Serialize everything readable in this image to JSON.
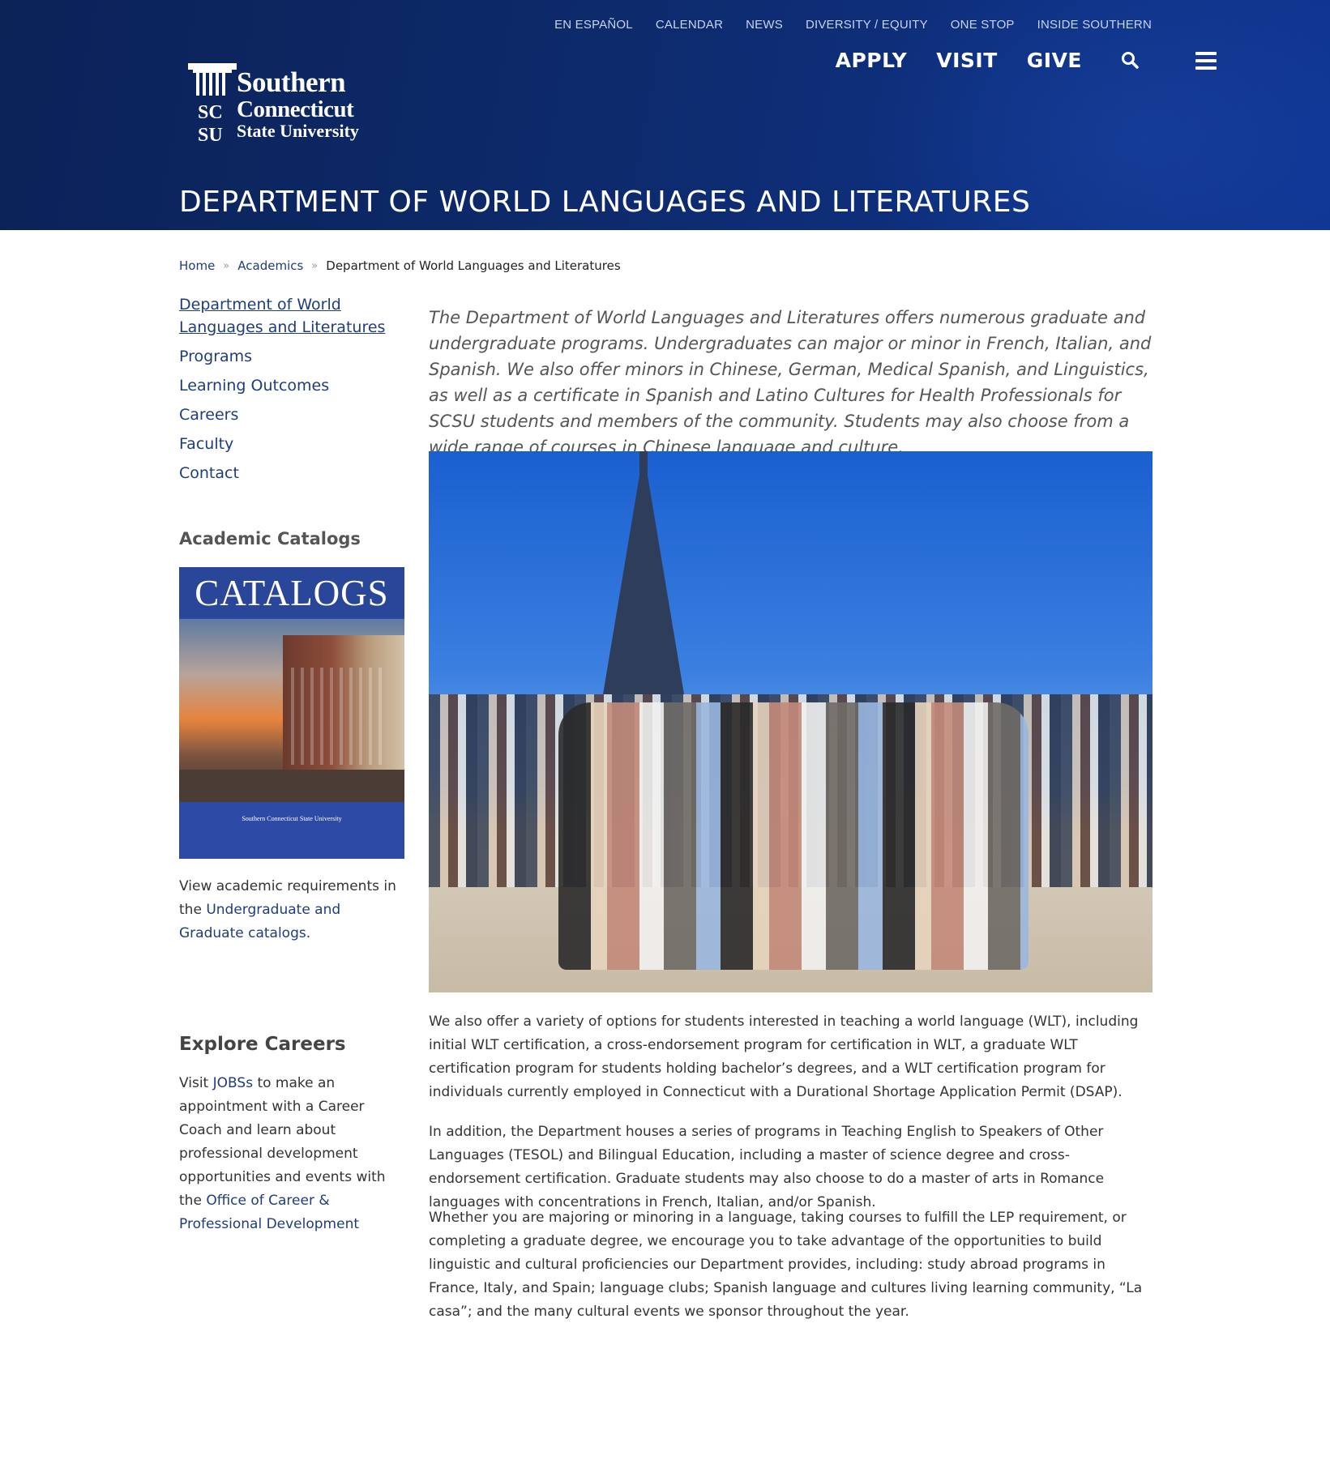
{
  "header": {
    "top_links": [
      "EN ESPAÑOL",
      "CALENDAR",
      "NEWS",
      "DIVERSITY / EQUITY",
      "ONE STOP",
      "INSIDE SOUTHERN"
    ],
    "nav": [
      "APPLY",
      "VISIT",
      "GIVE"
    ],
    "logo": {
      "line1": "Southern",
      "line2": "Connecticut",
      "line3": "State University",
      "mark": "SC SU"
    },
    "page_title": "DEPARTMENT OF WORLD LANGUAGES AND LITERATURES"
  },
  "breadcrumb": [
    "Home",
    "Academics",
    "Department of World Languages and Literatures"
  ],
  "sidebar": {
    "items": [
      "Department of World Languages and Literatures",
      "Programs",
      "Learning Outcomes",
      "Careers",
      "Faculty",
      "Contact"
    ],
    "catalogs_heading": "Academic Catalogs",
    "catalog_image": {
      "title": "CATALOGS",
      "footer": "Southern Connecticut State University"
    },
    "catalogs_text_prefix": "View academic requirements in the",
    "catalogs_link": "Undergraduate and Graduate catalogs",
    "catalogs_text_suffix": ".",
    "careers_heading": "Explore Careers",
    "careers_visit": "Visit",
    "careers_link1": "JOBSs",
    "careers_text": "to make an appointment with a Career Coach and learn about professional development opportunities and events with the",
    "careers_link2": "Office of Career & Professional Development"
  },
  "main": {
    "lead": "The Department of World Languages and Literatures offers numerous graduate and undergraduate programs. Undergraduates can major or minor in French, Italian, and Spanish. We also offer minors in Chinese, German, Medical Spanish, and Linguistics, as well as a certificate in Spanish and Latino Cultures for Health Professionals for SCSU students and members of the community. Students may also choose from a wide range of courses in Chinese language and culture.",
    "para1": "We also offer a variety of options for students interested in teaching a world language (WLT), including initial WLT certification, a cross-endorsement program for certification in WLT, a graduate WLT certification program for students holding bachelor’s degrees, and a WLT certification program for individuals currently employed in Connecticut with a Durational Shortage Application Permit (DSAP).",
    "para2": "In addition, the Department houses a series of programs in Teaching English to Speakers of Other Languages (TESOL) and Bilingual Education, including a master of science degree and cross-endorsement certification. Graduate students may also choose to do a master of arts in Romance languages with concentrations in French, Italian, and/or Spanish.",
    "para3": "Whether you are majoring or minoring in a language, taking courses to fulfill the LEP requirement, or completing a graduate degree, we encourage you to take advantage of the opportunities to build linguistic and cultural proficiencies our Department provides, including: study abroad programs in France, Italy, and Spain; language clubs; Spanish language and cultures living learning community, “La casa”; and the many cultural events we sponsor throughout the year."
  },
  "icons": {
    "search": "search-icon",
    "menu": "hamburger-menu-icon"
  }
}
